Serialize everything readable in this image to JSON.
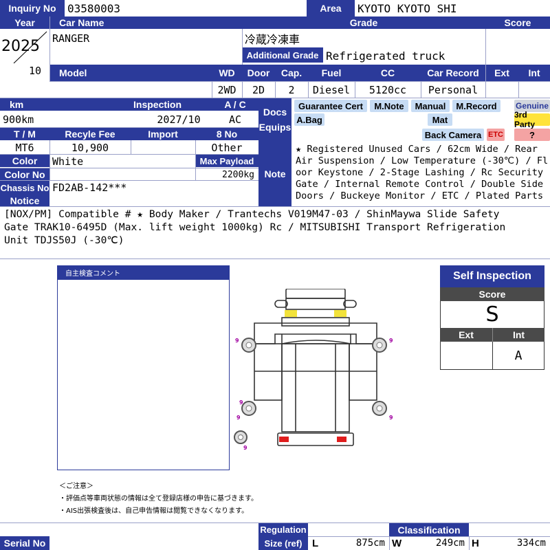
{
  "sheet": {
    "inquiry_no_label": "Inquiry No",
    "inquiry_no": "03580003",
    "area_label": "Area",
    "area": "KYOTO KYOTO SHI",
    "year_label": "Year",
    "year": "2025",
    "month": "10",
    "car_name_label": "Car Name",
    "car_name": "RANGER",
    "grade_label": "Grade",
    "grade": "冷蔵冷凍車",
    "additional_grade_label": "Additional Grade",
    "additional_grade": "Refrigerated truck",
    "score_label": "Score",
    "model_label": "Model",
    "wd_label": "WD",
    "door_label": "Door",
    "cap_label": "Cap.",
    "fuel_label": "Fuel",
    "cc_label": "CC",
    "car_record_label": "Car Record",
    "ext_label": "Ext",
    "int_label": "Int",
    "wd": "2WD",
    "door": "2D",
    "cap": "2",
    "fuel": "Diesel",
    "cc": "5120cc",
    "car_record": "Personal",
    "km_label": "km",
    "km": "900km",
    "inspection_label": "Inspection",
    "inspection": "2027/10",
    "ac_label": "A / C",
    "ac": "AC",
    "docs_equips_label_1": "Docs",
    "docs_equips_label_2": "Equips",
    "tm_label": "T / M",
    "tm": "MT6",
    "recycle_fee_label": "Recyle Fee",
    "recycle_fee": "10,900",
    "import_label": "Import",
    "no8_label": "8 No",
    "no8": "Other",
    "color_label": "Color",
    "color": "White",
    "max_payload_label": "Max Payload",
    "max_payload": "2200kg",
    "color_no_label": "Color No",
    "chassis_no_label": "Chassis No",
    "chassis_no": "FD2AB-142***",
    "notice_label": "Notice",
    "note_label": "Note",
    "note_lines": [
      "★ Registered Unused Cars / 62cm Wide / Rear",
      "Air Suspension / Low Temperature (-30℃) / Fl",
      "oor Keystone / 2-Stage Lashing / Rc Security",
      "Gate / Internal Remote Control / Double Side",
      "Doors / Buckeye Monitor / ETC / Plated Parts"
    ],
    "notice_lines": [
      "[NOX/PM] Compatible # ★ Body Maker / Trantechs V019M47-03 / ShinMaywa Slide Safety",
      "Gate TRAK10-6495D (Max. lift weight 1000kg) Rc / MITSUBISHI Transport Refrigeration",
      "Unit TDJS50J (-30℃)"
    ],
    "serial_no_label": "Serial No",
    "regulation_label": "Regulation",
    "size_label": "Size (ref)",
    "classification_label": "Classification",
    "l_label": "L",
    "l_value": "875cm",
    "w_label": "W",
    "w_value": "249cm",
    "h_label": "H",
    "h_value": "334cm"
  },
  "equipment": {
    "guarantee_cert": "Guarantee Cert",
    "m_note": "M.Note",
    "manual": "Manual",
    "m_record": "M.Record",
    "genuine": "Genuine",
    "a_bag": "A.Bag",
    "mat": "Mat",
    "third_party": "3rd Party",
    "back_camera": "Back Camera",
    "etc": "ETC",
    "question": "?"
  },
  "self_comment": {
    "title": "自主検査コメント",
    "caution_title": "＜ご注意＞",
    "caution_1": "・評価点等車両状態の情報は全て登録店様の申告に基づきます。",
    "caution_2": "・AIS出張検査後は、自己申告情報は閲覧できなくなります。"
  },
  "self_inspection": {
    "title": "Self Inspection",
    "score_label": "Score",
    "score": "S",
    "ext_label": "Ext",
    "int_label": "Int",
    "ext": "",
    "int": "A"
  },
  "diagram": {
    "tire_mark": "9"
  },
  "colors": {
    "header_blue": "#2b3a9a",
    "equip_blue": "#c7dcf4",
    "equip_yellow": "#ffe33a",
    "equip_red": "#f4a3a3",
    "marker_yellow": "#f2e23a",
    "marker_red": "#e01d1d"
  }
}
